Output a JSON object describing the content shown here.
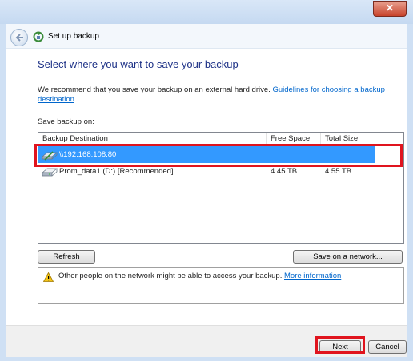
{
  "window": {
    "close_symbol": "✕"
  },
  "nav": {
    "title": "Set up backup",
    "back_icon": "back-arrow-icon",
    "app_icon": "backup-icon"
  },
  "main": {
    "heading": "Select where you want to save your backup",
    "recommend_text": "We recommend that you save your backup on an external hard drive. ",
    "recommend_link": "Guidelines for choosing a backup destination",
    "save_label": "Save backup on:"
  },
  "list": {
    "columns": [
      "Backup Destination",
      "Free Space",
      "Total Size"
    ],
    "rows": [
      {
        "name": "\\\\192.168.108.80",
        "free": "",
        "total": "",
        "selected": true,
        "icon": "network-drive-icon"
      },
      {
        "name": "Prom_data1 (D:) [Recommended]",
        "free": "4.45 TB",
        "total": "4.55 TB",
        "selected": false,
        "icon": "hard-drive-icon"
      }
    ]
  },
  "buttons": {
    "refresh": "Refresh",
    "save_network": "Save on a network...",
    "next": "Next",
    "cancel": "Cancel"
  },
  "warning": {
    "text": "Other people on the network might be able to access your backup. ",
    "link": "More information",
    "icon": "warning-icon"
  },
  "colors": {
    "selection": "#3399ff",
    "highlight": "#e0141e",
    "link": "#0066cc",
    "heading": "#1e3287"
  }
}
